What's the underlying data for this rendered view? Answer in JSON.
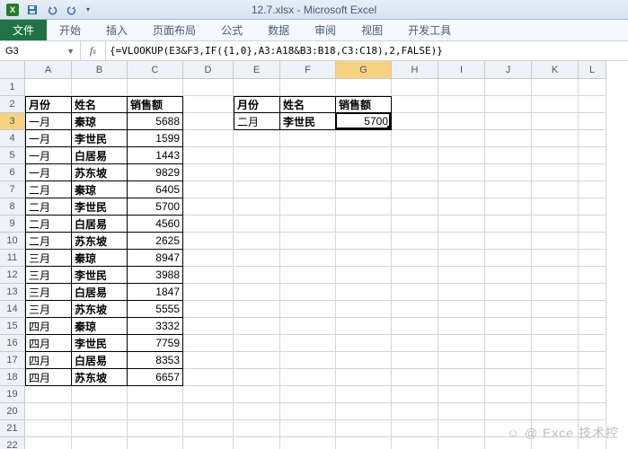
{
  "title": "12.7.xlsx - Microsoft Excel",
  "tabs": {
    "file": "文件",
    "list": [
      "开始",
      "插入",
      "页面布局",
      "公式",
      "数据",
      "审阅",
      "视图",
      "开发工具"
    ]
  },
  "namebox": "G3",
  "formula": "{=VLOOKUP(E3&F3,IF({1,0},A3:A18&B3:B18,C3:C18),2,FALSE)}",
  "active": {
    "col": "G",
    "row": 3
  },
  "columns": [
    "A",
    "B",
    "C",
    "D",
    "E",
    "F",
    "G",
    "H",
    "I",
    "J",
    "K",
    "L"
  ],
  "colWidths": {
    "A": 52,
    "B": 62,
    "C": 62,
    "D": 56,
    "E": 52,
    "F": 62,
    "G": 62,
    "H": 52,
    "I": 52,
    "J": 52,
    "K": 52,
    "L": 31
  },
  "maxRow": 22,
  "headers1": {
    "A": "月份",
    "B": "姓名",
    "C": "销售额"
  },
  "headers2": {
    "E": "月份",
    "F": "姓名",
    "G": "销售额"
  },
  "lookup": {
    "E": "二月",
    "F": "李世民",
    "G": "5700"
  },
  "data": [
    {
      "A": "一月",
      "B": "秦琼",
      "C": 5688
    },
    {
      "A": "一月",
      "B": "李世民",
      "C": 1599
    },
    {
      "A": "一月",
      "B": "白居易",
      "C": 1443
    },
    {
      "A": "一月",
      "B": "苏东坡",
      "C": 9829
    },
    {
      "A": "二月",
      "B": "秦琼",
      "C": 6405
    },
    {
      "A": "二月",
      "B": "李世民",
      "C": 5700
    },
    {
      "A": "二月",
      "B": "白居易",
      "C": 4560
    },
    {
      "A": "二月",
      "B": "苏东坡",
      "C": 2625
    },
    {
      "A": "三月",
      "B": "秦琼",
      "C": 8947
    },
    {
      "A": "三月",
      "B": "李世民",
      "C": 3988
    },
    {
      "A": "三月",
      "B": "白居易",
      "C": 1847
    },
    {
      "A": "三月",
      "B": "苏东坡",
      "C": 5555
    },
    {
      "A": "四月",
      "B": "秦琼",
      "C": 3332
    },
    {
      "A": "四月",
      "B": "李世民",
      "C": 7759
    },
    {
      "A": "四月",
      "B": "白居易",
      "C": 8353
    },
    {
      "A": "四月",
      "B": "苏东坡",
      "C": 6657
    }
  ],
  "watermark": "☺ @ Exce 技术控",
  "chart_data": {
    "type": "table",
    "title": "销售额 by 月份 × 姓名",
    "columns": [
      "月份",
      "姓名",
      "销售额"
    ],
    "rows": [
      [
        "一月",
        "秦琼",
        5688
      ],
      [
        "一月",
        "李世民",
        1599
      ],
      [
        "一月",
        "白居易",
        1443
      ],
      [
        "一月",
        "苏东坡",
        9829
      ],
      [
        "二月",
        "秦琼",
        6405
      ],
      [
        "二月",
        "李世民",
        5700
      ],
      [
        "二月",
        "白居易",
        4560
      ],
      [
        "二月",
        "苏东坡",
        2625
      ],
      [
        "三月",
        "秦琼",
        8947
      ],
      [
        "三月",
        "李世民",
        3988
      ],
      [
        "三月",
        "白居易",
        1847
      ],
      [
        "三月",
        "苏东坡",
        5555
      ],
      [
        "四月",
        "秦琼",
        3332
      ],
      [
        "四月",
        "李世民",
        7759
      ],
      [
        "四月",
        "白居易",
        8353
      ],
      [
        "四月",
        "苏东坡",
        6657
      ]
    ]
  }
}
